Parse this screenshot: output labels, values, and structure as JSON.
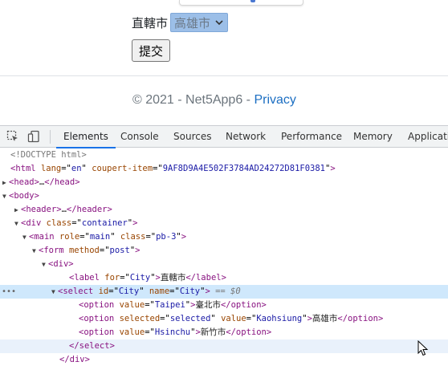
{
  "page": {
    "label": "直轄市",
    "select_value": "高雄市",
    "submit_label": "提交",
    "footer_prefix": "© 2021 - Net5App6 - ",
    "footer_link": "Privacy"
  },
  "devtools": {
    "tabs": [
      "Elements",
      "Console",
      "Sources",
      "Network",
      "Performance",
      "Memory",
      "Application"
    ],
    "active_tab": "Elements",
    "selected_marker": "== $0",
    "lines": [
      {
        "indent": 0,
        "html": "<span class='gray'>&lt;!DOCTYPE html&gt;</span>"
      }
    ]
  },
  "colors": {
    "accent": "#1a73e8",
    "select_bg": "#9cbfe8",
    "link": "#1b6ec2",
    "selected_row": "#cfe8fc"
  }
}
